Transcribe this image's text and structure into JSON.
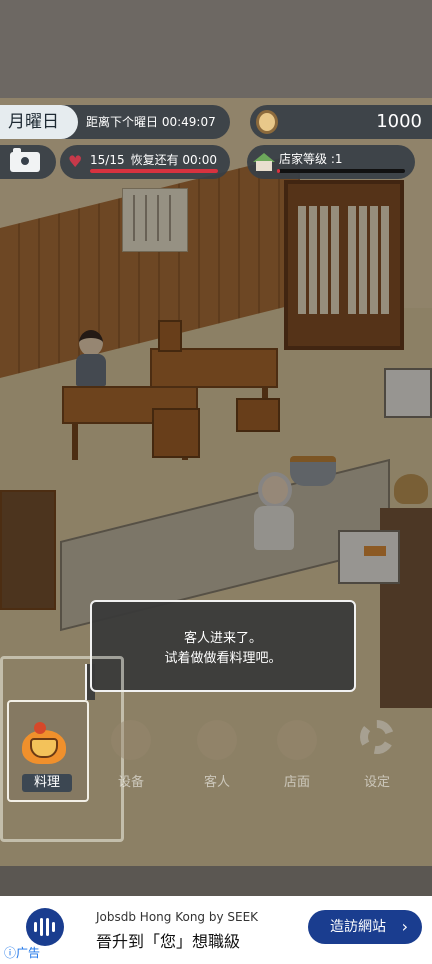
{
  "hud": {
    "day": "月曜日",
    "next_day": "距离下个曜日 00:49:07",
    "coins": "1000",
    "stamina": "15/15",
    "recover": "恢复还有 00:00",
    "stamina_fraction": 1.0,
    "level": "店家等级 :1",
    "level_fraction": 0.02
  },
  "tutorial": {
    "line1": "客人进来了。",
    "line2": "试着做做看料理吧。"
  },
  "nav": {
    "items": [
      {
        "label": "料理",
        "icon": "cooking-pot-icon",
        "active": true
      },
      {
        "label": "设备",
        "icon": "equipment-icon",
        "active": false
      },
      {
        "label": "客人",
        "icon": "guests-icon",
        "active": false
      },
      {
        "label": "店面",
        "icon": "shop-icon",
        "active": false
      },
      {
        "label": "设定",
        "icon": "gear-icon",
        "active": false
      }
    ]
  },
  "ad": {
    "tag": "广告",
    "sponsor": "Jobsdb Hong Kong by SEEK",
    "headline": "晉升到「您」想職級",
    "button": "造訪網站"
  },
  "colors": {
    "hud_bg": "#373f46",
    "stamina_red": "#d8323f",
    "ad_blue": "#1a3d8f"
  }
}
